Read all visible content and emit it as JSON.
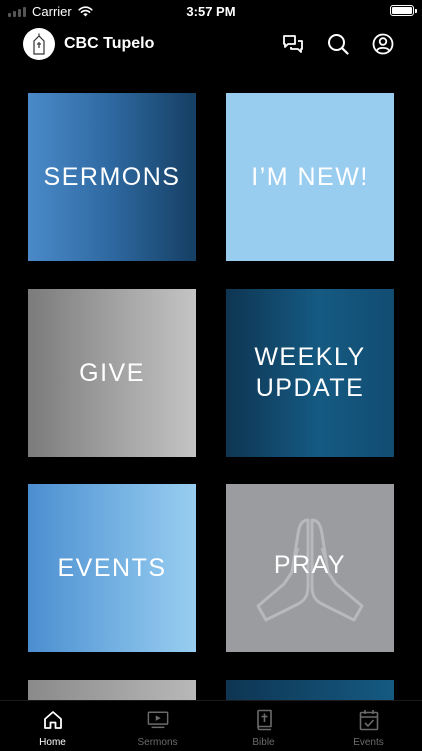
{
  "status_bar": {
    "carrier": "Carrier",
    "time": "3:57 PM",
    "icons": [
      "cellular-signal-icon",
      "wifi-icon",
      "battery-icon"
    ]
  },
  "header": {
    "title": "CBC Tupelo",
    "logo": "church-logo",
    "icons": [
      "chat-icon",
      "search-icon",
      "account-icon"
    ]
  },
  "tiles": [
    {
      "label": "SERMONS",
      "color": "#2e68a0"
    },
    {
      "label": "I’M NEW!",
      "color": "#99cdf0"
    },
    {
      "label": "GIVE",
      "color": "#a4a4a4"
    },
    {
      "label": "WEEKLY\nUPDATE",
      "color": "#155a82"
    },
    {
      "label": "EVENTS",
      "color": "#76b3e3"
    },
    {
      "label": "PRAY",
      "color": "#9a9c9f",
      "icon": "praying-hands-icon"
    }
  ],
  "tab_bar": {
    "items": [
      {
        "label": "Home",
        "icon": "home-icon",
        "active": true
      },
      {
        "label": "Sermons",
        "icon": "video-icon",
        "active": false
      },
      {
        "label": "Bible",
        "icon": "bible-icon",
        "active": false
      },
      {
        "label": "Events",
        "icon": "calendar-check-icon",
        "active": false
      }
    ],
    "active_color": "#ffffff",
    "inactive_color": "#6b6b6b"
  }
}
